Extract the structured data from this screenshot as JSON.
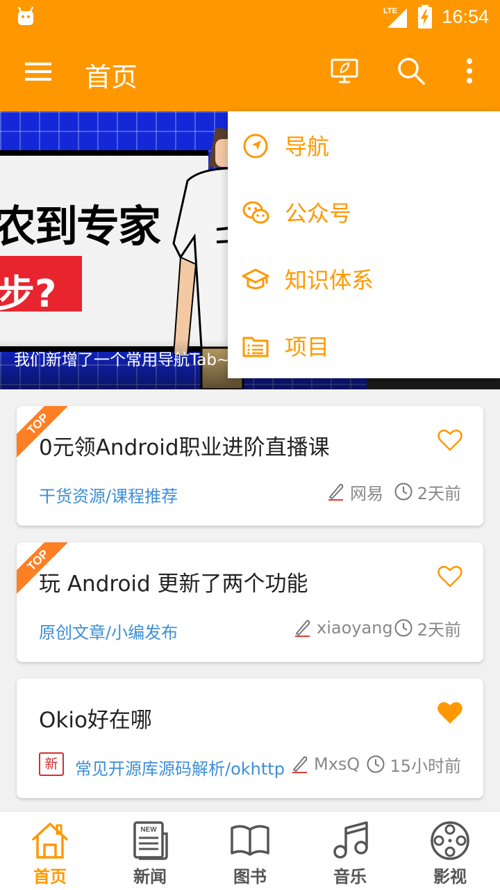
{
  "status_bar": {
    "network": "LTE",
    "time": "16:54"
  },
  "toolbar": {
    "title": "首页"
  },
  "banner": {
    "line1": "码农到专家",
    "line2": "几步?",
    "caption": "我们新增了一个常用导航Tab~"
  },
  "popup_menu": {
    "items": [
      {
        "label": "导航",
        "icon": "navigation-icon"
      },
      {
        "label": "公众号",
        "icon": "wechat-icon"
      },
      {
        "label": "知识体系",
        "icon": "graduation-cap-icon"
      },
      {
        "label": "项目",
        "icon": "folder-list-icon"
      }
    ]
  },
  "articles": [
    {
      "title": "0元领Android职业进阶直播课",
      "category": "干货资源/课程推荐",
      "author": "网易",
      "time": "2天前",
      "top": true,
      "badge": "TOP",
      "liked": false
    },
    {
      "title": "玩 Android 更新了两个功能",
      "category": "原创文章/小编发布",
      "author": "xiaoyang",
      "time": "2天前",
      "top": true,
      "badge": "TOP",
      "liked": false
    },
    {
      "title": "Okio好在哪",
      "category": "常见开源库源码解析/okhttp",
      "author": "MxsQ",
      "time": "15小时前",
      "top": false,
      "new_tag": "新",
      "liked": true
    }
  ],
  "bottom_nav": {
    "items": [
      {
        "label": "首页",
        "icon": "home-icon",
        "active": true
      },
      {
        "label": "新闻",
        "icon": "news-icon",
        "badge": "NEW",
        "active": false
      },
      {
        "label": "图书",
        "icon": "book-icon",
        "active": false
      },
      {
        "label": "音乐",
        "icon": "music-icon",
        "active": false
      },
      {
        "label": "影视",
        "icon": "film-reel-icon",
        "active": false
      }
    ]
  },
  "colors": {
    "primary": "#ff9800",
    "link": "#3d8fd6",
    "tag_red": "#d32f2f"
  }
}
